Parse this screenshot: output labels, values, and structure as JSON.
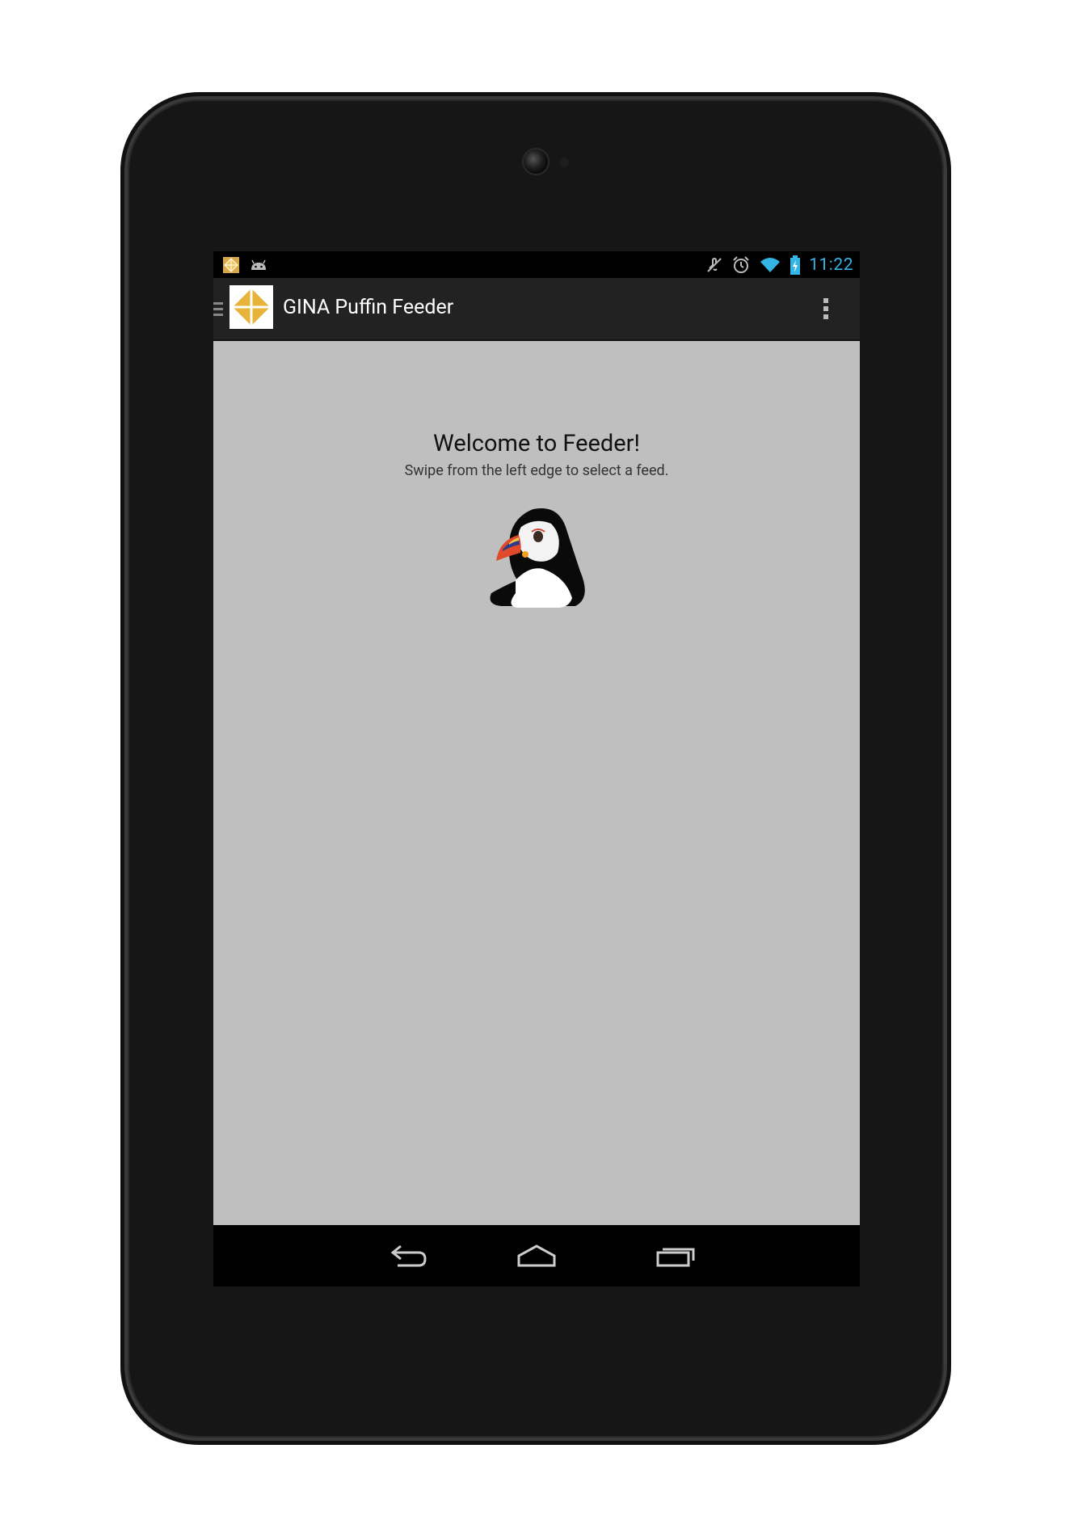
{
  "statusbar": {
    "left_icons": [
      "gina-app-icon",
      "android-icon"
    ],
    "right_icons": [
      "mute-icon",
      "alarm-icon",
      "wifi-icon",
      "battery-charging-icon"
    ],
    "time": "11:22",
    "time_color": "#33b5e5"
  },
  "actionbar": {
    "title": "GINA Puffin Feeder",
    "logo_icon": "gina-logo-icon",
    "drawer_icon": "drawer-indicator-icon",
    "overflow_icon": "overflow-menu-icon",
    "logo_color": "#e8b33b"
  },
  "content": {
    "welcome_title": "Welcome to Feeder!",
    "welcome_subtitle": "Swipe from the left edge to select a feed.",
    "image_icon": "puffin-icon",
    "background": "#bfbfbf"
  },
  "navbar": {
    "buttons": [
      "back-icon",
      "home-icon",
      "recents-icon"
    ]
  }
}
